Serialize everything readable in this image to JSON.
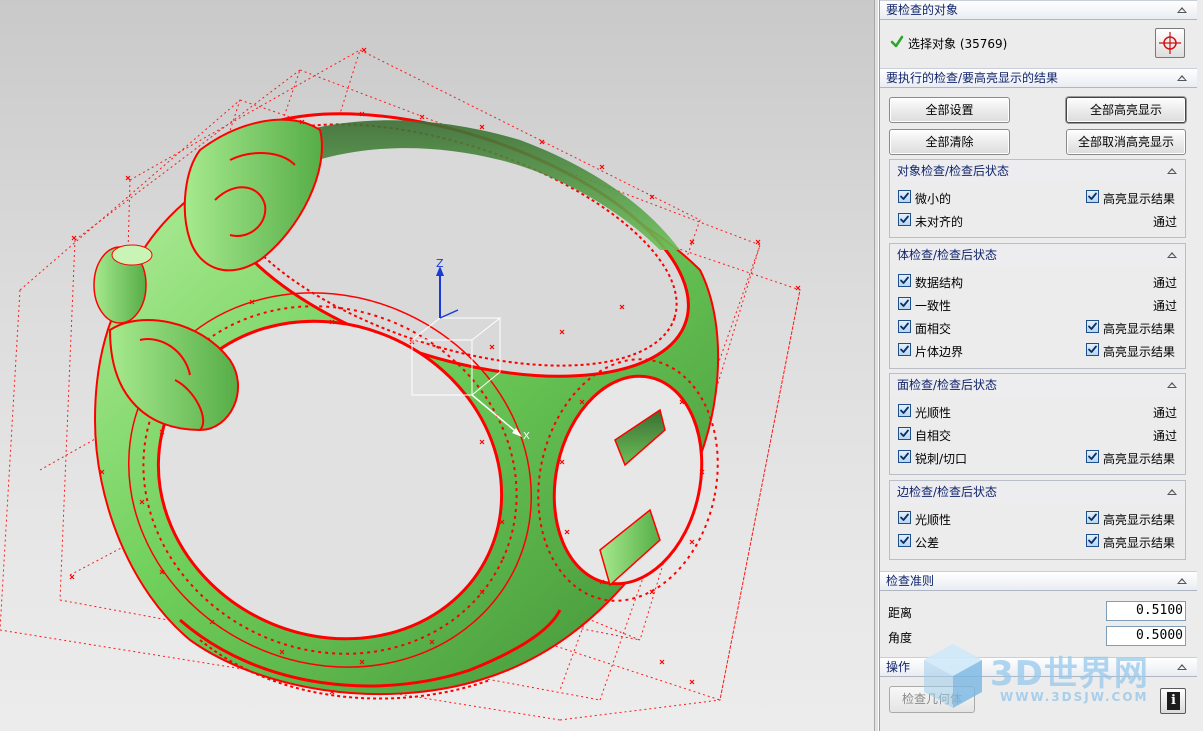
{
  "sections": {
    "object_to_check": "要检查的对象",
    "checks_to_run": "要执行的检查/要高亮显示的结果",
    "criteria": "检查准则",
    "actions": "操作"
  },
  "selection": {
    "label": "选择对象 (35769)"
  },
  "buttons": {
    "set_all": "全部设置",
    "highlight_all": "全部高亮显示",
    "clear_all": "全部清除",
    "unhighlight_all": "全部取消高亮显示",
    "check_geometry": "检查几何体"
  },
  "groups": [
    {
      "title": "对象检查/检查后状态",
      "rows": [
        {
          "label": "微小的",
          "checked": true,
          "right_check": true,
          "right_label": "高亮显示结果"
        },
        {
          "label": "未对齐的",
          "checked": true,
          "status": "通过"
        }
      ]
    },
    {
      "title": "体检查/检查后状态",
      "rows": [
        {
          "label": "数据结构",
          "checked": true,
          "status": "通过"
        },
        {
          "label": "一致性",
          "checked": true,
          "status": "通过"
        },
        {
          "label": "面相交",
          "checked": true,
          "right_check": true,
          "right_label": "高亮显示结果"
        },
        {
          "label": "片体边界",
          "checked": true,
          "right_check": true,
          "right_label": "高亮显示结果"
        }
      ]
    },
    {
      "title": "面检查/检查后状态",
      "rows": [
        {
          "label": "光顺性",
          "checked": true,
          "status": "通过"
        },
        {
          "label": "自相交",
          "checked": true,
          "status": "通过"
        },
        {
          "label": "锐刺/切口",
          "checked": true,
          "right_check": true,
          "right_label": "高亮显示结果"
        }
      ]
    },
    {
      "title": "边检查/检查后状态",
      "rows": [
        {
          "label": "光顺性",
          "checked": true,
          "right_check": true,
          "right_label": "高亮显示结果"
        },
        {
          "label": "公差",
          "checked": true,
          "right_check": true,
          "right_label": "高亮显示结果"
        }
      ]
    }
  ],
  "criteria": {
    "distance_label": "距离",
    "distance_value": "0.5100",
    "angle_label": "角度",
    "angle_value": "0.5000"
  },
  "viewport": {
    "axis_z": "Z",
    "axis_x": "X"
  },
  "watermark": {
    "text": "3D世界网",
    "sub": "WWW.3DSJW.COM"
  },
  "colors": {
    "model_green": "#7ed36a",
    "check_red": "#ff0000",
    "header_text": "#10246a"
  }
}
